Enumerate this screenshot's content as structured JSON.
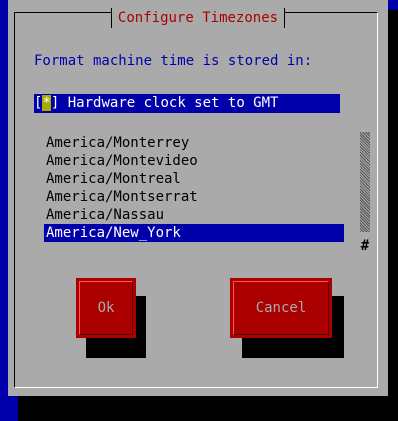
{
  "dialog": {
    "title": "Configure Timezones",
    "prompt": "Format machine time is stored in:",
    "checkbox": {
      "open_bracket": "[",
      "mark": "*",
      "close_bracket": "]",
      "label": " Hardware clock set to GMT",
      "checked": true
    },
    "timezones": [
      {
        "label": "America/Monterrey",
        "selected": false
      },
      {
        "label": "America/Montevideo",
        "selected": false
      },
      {
        "label": "America/Montreal",
        "selected": false
      },
      {
        "label": "America/Montserrat",
        "selected": false
      },
      {
        "label": "America/Nassau",
        "selected": false
      },
      {
        "label": "America/New_York",
        "selected": true
      }
    ],
    "scroll_thumb_glyph": "#",
    "buttons": {
      "ok_label": "Ok",
      "cancel_label": "Cancel"
    }
  },
  "colors": {
    "background": "#0000aa",
    "dialog": "#aaaaaa",
    "title": "#aa0000",
    "button": "#aa0000",
    "selection": "#0000aa",
    "checkbox_mark": "#aaaa00"
  }
}
